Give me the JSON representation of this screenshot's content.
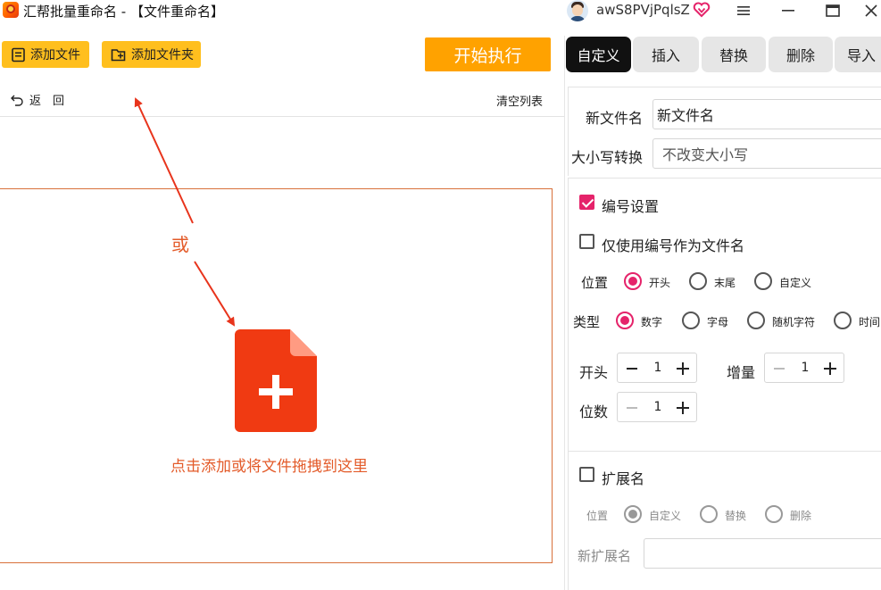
{
  "titlebar": {
    "title": "汇帮批量重命名 - 【文件重命名】",
    "username": "awS8PVjPqlsZ",
    "icons": [
      "app-logo",
      "user-avatar",
      "vip-heart-icon",
      "menu-icon",
      "minimize-icon",
      "maximize-icon",
      "close-icon"
    ]
  },
  "toolbar": {
    "add_file": "添加文件",
    "add_folder": "添加文件夹",
    "start": "开始执行",
    "back": "返　回",
    "clear_list": "清空列表"
  },
  "dropzone": {
    "or_label": "或",
    "hint": "点击添加或将文件拖拽到这里"
  },
  "tabs": [
    {
      "label": "自定义",
      "active": true
    },
    {
      "label": "插入",
      "active": false
    },
    {
      "label": "替换",
      "active": false
    },
    {
      "label": "删除",
      "active": false
    },
    {
      "label": "导入",
      "active": false
    }
  ],
  "panel": {
    "new_name_label": "新文件名",
    "new_name_value": "新文件名",
    "case_label": "大小写转换",
    "case_value": "不改变大小写",
    "numbering": {
      "label": "编号设置",
      "checked": true,
      "only_number_label": "仅使用编号作为文件名",
      "only_number_checked": false,
      "position_label": "位置",
      "position_options": [
        "开头",
        "末尾",
        "自定义"
      ],
      "position_selected": "开头",
      "type_label": "类型",
      "type_options": [
        "数字",
        "字母",
        "随机字符",
        "时间"
      ],
      "type_selected": "数字",
      "start_label": "开头",
      "start_value": "1",
      "increment_label": "增量",
      "increment_value": "1",
      "digits_label": "位数",
      "digits_value": "1"
    },
    "extension": {
      "label": "扩展名",
      "checked": false,
      "position_label": "位置",
      "options": [
        "自定义",
        "替换",
        "删除"
      ],
      "selected": "自定义",
      "new_ext_label": "新扩展名",
      "new_ext_value": ""
    }
  },
  "colors": {
    "accent_yellow": "#ffbf1e",
    "start_orange": "#ffa200",
    "drop_red": "#f03a12",
    "hint_red": "#e35b2a",
    "check_pink": "#e5236a",
    "tab_active": "#111111"
  }
}
